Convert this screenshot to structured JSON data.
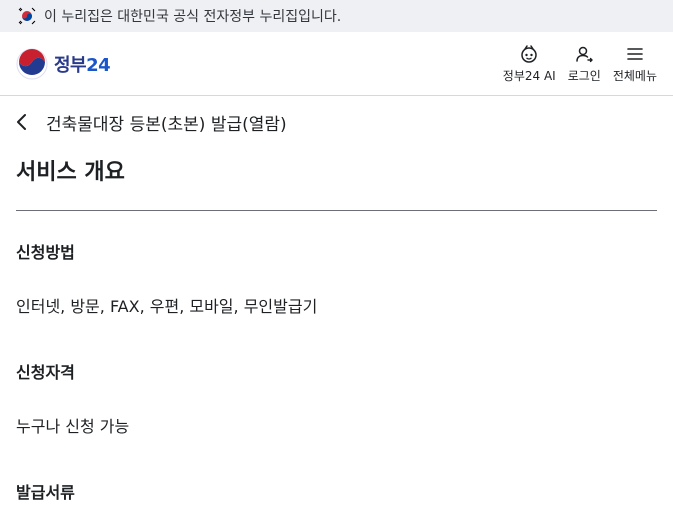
{
  "topbar": {
    "notice": "이 누리집은 대한민국 공식 전자정부 누리집입니다.",
    "flag_icon": "korea-flag-icon"
  },
  "header": {
    "logo_text": "정부",
    "logo_num": "24",
    "logo_icon": "government-emblem-icon",
    "actions": [
      {
        "label": "정부24 AI",
        "icon": "ai-assistant-icon"
      },
      {
        "label": "로그인",
        "icon": "login-user-icon"
      },
      {
        "label": "전체메뉴",
        "icon": "hamburger-menu-icon"
      }
    ]
  },
  "breadcrumb": {
    "back_icon": "chevron-left-icon",
    "title": "건축물대장 등본(초본) 발급(열람)"
  },
  "main": {
    "section_title": "서비스 개요",
    "items": [
      {
        "label": "신청방법",
        "value": "인터넷, 방문, FAX, 우편, 모바일, 무인발급기"
      },
      {
        "label": "신청자격",
        "value": "누구나 신청 가능"
      },
      {
        "label": "발급서류",
        "value": ""
      }
    ]
  },
  "colors": {
    "topbar_bg": "#eef0f3",
    "brand_blue": "#2a3a8a",
    "accent_red": "#e02a3a",
    "divider": "#6b6e75"
  }
}
